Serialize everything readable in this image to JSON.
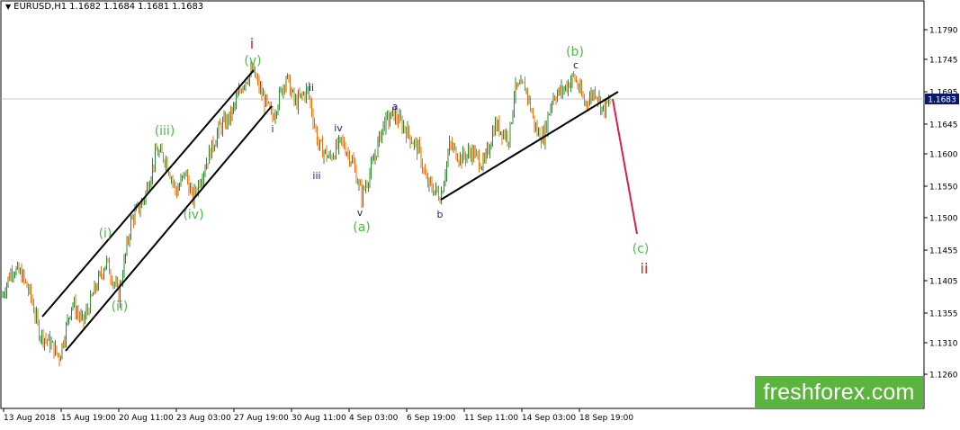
{
  "header": {
    "symbol": "EURUSD,H1",
    "open": "1.1682",
    "high": "1.1684",
    "low": "1.1681",
    "close": "1.1683",
    "arrow": "▼"
  },
  "watermark": "freshforex.com",
  "colors": {
    "bull": "#2e8b2e",
    "bear": "#e8720c",
    "wave_green": "#4cbb47",
    "wave_red": "#e02020",
    "wave_navy": "#1a237e",
    "forecast_line": "#d6204e",
    "price_line": "#c8c8c8",
    "price_box": "#0a1a6a"
  },
  "chart_data": {
    "type": "candlestick",
    "symbol": "EURUSD",
    "timeframe": "H1",
    "ylim": [
      1.1235,
      1.183
    ],
    "y_ticks": [
      "1.1790",
      "1.1745",
      "1.1695",
      "1.1645",
      "1.1600",
      "1.1550",
      "1.1500",
      "1.1455",
      "1.1405",
      "1.1355",
      "1.1310",
      "1.1260"
    ],
    "x_ticks": [
      "13 Aug 2018",
      "15 Aug 19:00",
      "20 Aug 11:00",
      "23 Aug 03:00",
      "27 Aug 19:00",
      "30 Aug 11:00",
      "4 Sep 03:00",
      "6 Sep 19:00",
      "11 Sep 11:00",
      "14 Sep 03:00",
      "18 Sep 19:00"
    ],
    "current_price": "1.1683",
    "path": [
      [
        0,
        1.139
      ],
      [
        8,
        1.142
      ],
      [
        14,
        1.144
      ],
      [
        24,
        1.143
      ],
      [
        34,
        1.14
      ],
      [
        44,
        1.1345
      ],
      [
        56,
        1.133
      ],
      [
        66,
        1.131
      ],
      [
        80,
        1.139
      ],
      [
        92,
        1.136
      ],
      [
        106,
        1.141
      ],
      [
        118,
        1.145
      ],
      [
        132,
        1.14
      ],
      [
        146,
        1.151
      ],
      [
        160,
        1.154
      ],
      [
        174,
        1.161
      ],
      [
        184,
        1.16
      ],
      [
        196,
        1.155
      ],
      [
        206,
        1.158
      ],
      [
        214,
        1.154
      ],
      [
        228,
        1.159
      ],
      [
        244,
        1.1645
      ],
      [
        256,
        1.166
      ],
      [
        270,
        1.171
      ],
      [
        281,
        1.1728
      ],
      [
        292,
        1.169
      ],
      [
        303,
        1.166
      ],
      [
        318,
        1.172
      ],
      [
        328,
        1.168
      ],
      [
        342,
        1.17
      ],
      [
        354,
        1.162
      ],
      [
        366,
        1.16
      ],
      [
        380,
        1.1625
      ],
      [
        392,
        1.1595
      ],
      [
        402,
        1.1545
      ],
      [
        414,
        1.159
      ],
      [
        426,
        1.165
      ],
      [
        438,
        1.1665
      ],
      [
        452,
        1.164
      ],
      [
        466,
        1.161
      ],
      [
        474,
        1.1565
      ],
      [
        490,
        1.1545
      ],
      [
        500,
        1.162
      ],
      [
        512,
        1.16
      ],
      [
        524,
        1.161
      ],
      [
        538,
        1.159
      ],
      [
        550,
        1.165
      ],
      [
        566,
        1.163
      ],
      [
        572,
        1.17
      ],
      [
        584,
        1.1705
      ],
      [
        596,
        1.164
      ],
      [
        604,
        1.163
      ],
      [
        614,
        1.169
      ],
      [
        626,
        1.17
      ],
      [
        638,
        1.172
      ],
      [
        650,
        1.168
      ],
      [
        662,
        1.17
      ],
      [
        670,
        1.167
      ],
      [
        678,
        1.1683
      ]
    ],
    "lines": [
      {
        "name": "channel-upper",
        "from": [
          "15 Aug 2018",
          1.135
        ],
        "to": [
          "27 Aug 2018",
          1.173
        ]
      },
      {
        "name": "channel-lower",
        "from": [
          "16 Aug 2018",
          1.13
        ],
        "to": [
          "29 Aug 2018",
          1.167
        ]
      },
      {
        "name": "trendline",
        "from": [
          "7 Sep 2018",
          1.153
        ],
        "to": [
          "19 Sep 2018",
          1.1695
        ]
      },
      {
        "name": "forecast",
        "from": [
          "19 Sep 2018",
          1.1683
        ],
        "to": [
          "20 Sep 2018",
          1.148
        ]
      }
    ],
    "wave_labels": [
      {
        "text": "i",
        "color": "red",
        "at": [
          "27 Aug 19:00",
          1.1775
        ]
      },
      {
        "text": "(v)",
        "color": "green",
        "at": [
          "27 Aug 19:00",
          1.1745
        ]
      },
      {
        "text": "(iii)",
        "color": "green",
        "at": [
          "22 Aug 2018",
          1.164
        ]
      },
      {
        "text": "(iv)",
        "color": "green",
        "at": [
          "23 Aug 2018",
          1.151
        ]
      },
      {
        "text": "(i)",
        "color": "green",
        "at": [
          "17 Aug 2018",
          1.1475
        ]
      },
      {
        "text": "(ii)",
        "color": "green",
        "at": [
          "20 Aug 2018",
          1.139
        ]
      },
      {
        "text": "i",
        "color": "navy",
        "at": [
          "29 Aug 2018",
          1.1655
        ]
      },
      {
        "text": "ii",
        "color": "navy",
        "at": [
          "31 Aug 2018",
          1.1715
        ]
      },
      {
        "text": "iii",
        "color": "navy",
        "at": [
          "3 Sep 2018",
          1.157
        ]
      },
      {
        "text": "iv",
        "color": "navy",
        "at": [
          "3 Sep 2018",
          1.1655
        ]
      },
      {
        "text": "v",
        "color": "navy",
        "at": [
          "4 Sep 2018",
          1.1505
        ]
      },
      {
        "text": "(a)",
        "color": "green",
        "at": [
          "4 Sep 2018",
          1.149
        ]
      },
      {
        "text": "a",
        "color": "navy",
        "at": [
          "5 Sep 2018",
          1.168
        ]
      },
      {
        "text": "b",
        "color": "navy",
        "at": [
          "7 Sep 2018",
          1.1505
        ]
      },
      {
        "text": "c",
        "color": "navy",
        "at": [
          "17 Sep 2018",
          1.1748
        ]
      },
      {
        "text": "(b)",
        "color": "green",
        "at": [
          "17 Sep 2018",
          1.1765
        ]
      },
      {
        "text": "(c)",
        "color": "green",
        "at": [
          "20 Sep 2018",
          1.1458
        ]
      },
      {
        "text": "ii",
        "color": "red",
        "at": [
          "20 Sep 2018",
          1.144
        ]
      }
    ]
  }
}
